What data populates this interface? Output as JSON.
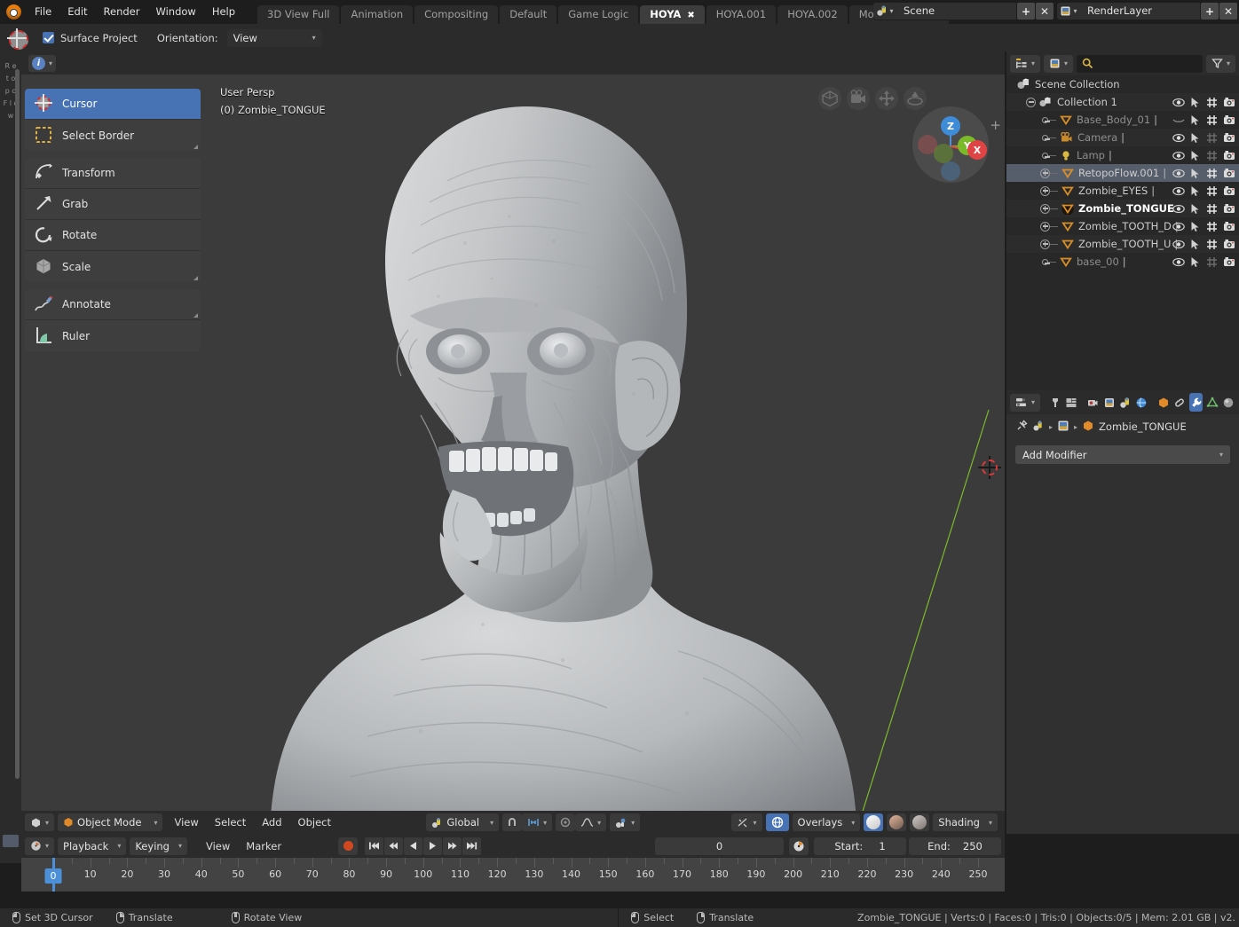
{
  "topbar": {
    "logo_icon": "blender-logo-icon",
    "menus": [
      "File",
      "Edit",
      "Render",
      "Window",
      "Help"
    ],
    "workspace_tabs": [
      {
        "label": "3D View Full",
        "active": false,
        "closable": false
      },
      {
        "label": "Animation",
        "active": false,
        "closable": false
      },
      {
        "label": "Compositing",
        "active": false,
        "closable": false
      },
      {
        "label": "Default",
        "active": false,
        "closable": false
      },
      {
        "label": "Game Logic",
        "active": false,
        "closable": false
      },
      {
        "label": "HOYA",
        "active": true,
        "closable": true
      },
      {
        "label": "HOYA.001",
        "active": false,
        "closable": false
      },
      {
        "label": "HOYA.002",
        "active": false,
        "closable": false
      },
      {
        "label": "Motion Tracking",
        "active": false,
        "closable": false
      }
    ],
    "scene_datablock": {
      "icon": "scene-icon",
      "value": "Scene",
      "add_label": "+",
      "remove_label": "✕"
    },
    "renderlayer_datablock": {
      "icon": "renderlayer-icon",
      "value": "RenderLayer",
      "add_label": "+",
      "remove_label": "✕"
    }
  },
  "tool_settings": {
    "gizmo_icon": "3d-cursor-icon",
    "checkbox_label": "Surface Project",
    "checkbox_checked": true,
    "orientation_label": "Orientation:",
    "orientation_value": "View"
  },
  "viewport": {
    "header_info_icon": "info-icon",
    "overlay_line1": "User Persp",
    "overlay_line2": "(0) Zombie_TONGUE",
    "plus_label": "+",
    "gizmos": [
      "perspective-ortho-icon",
      "camera-view-icon",
      "move-view-icon",
      "zoom-view-icon"
    ],
    "axis_gizmo": {
      "z": "Z",
      "y": "Y",
      "x": "X"
    },
    "cursor_icon": "3d-cursor-icon"
  },
  "toolbar": {
    "groups": [
      [
        {
          "label": "Cursor",
          "icon": "cursor-tool-icon",
          "selected": true,
          "has_submenu": false
        },
        {
          "label": "Select Border",
          "icon": "select-border-icon",
          "selected": false,
          "has_submenu": true
        }
      ],
      [
        {
          "label": "Transform",
          "icon": "transform-icon",
          "selected": false,
          "has_submenu": false
        },
        {
          "label": "Grab",
          "icon": "grab-icon",
          "selected": false,
          "has_submenu": false
        },
        {
          "label": "Rotate",
          "icon": "rotate-icon",
          "selected": false,
          "has_submenu": false
        },
        {
          "label": "Scale",
          "icon": "scale-icon",
          "selected": false,
          "has_submenu": true
        }
      ],
      [
        {
          "label": "Annotate",
          "icon": "annotate-icon",
          "selected": false,
          "has_submenu": true
        },
        {
          "label": "Ruler",
          "icon": "ruler-icon",
          "selected": false,
          "has_submenu": false
        }
      ]
    ]
  },
  "viewport_footer": {
    "editor_type_icon": "editor-type-icon",
    "mode": "Object Mode",
    "menus": [
      "View",
      "Select",
      "Add",
      "Object"
    ],
    "transform_orientation": "Global",
    "snap_icon": "snap-magnet-icon",
    "pivot_icon": "pivot-icon",
    "proportional_icon": "proportional-edit-icon",
    "falloff_icon": "falloff-curve-icon",
    "gizmo_icon": "gizmo-icon",
    "xray_icon": "xray-icon",
    "overlays_label": "Overlays",
    "shading_label": "Shading",
    "shading_modes": [
      "wireframe-solid-ball",
      "material-ball",
      "rendered-ball"
    ]
  },
  "timeline": {
    "editor_icon": "timeline-icon",
    "menus_dropdown": [
      "Playback",
      "Keying"
    ],
    "menus": [
      "View",
      "Marker"
    ],
    "record_icon": "record-icon",
    "transport": [
      "jump-start-icon",
      "prev-keyframe-icon",
      "play-reverse-icon",
      "play-icon",
      "next-keyframe-icon",
      "jump-end-icon"
    ],
    "current_frame": "0",
    "autokey_icon": "auto-keying-icon",
    "start_label": "Start:",
    "start_value": "1",
    "end_label": "End:",
    "end_value": "250",
    "ruler_ticks": [
      0,
      10,
      20,
      30,
      40,
      50,
      60,
      70,
      80,
      90,
      100,
      110,
      120,
      130,
      140,
      150,
      160,
      170,
      180,
      190,
      200,
      210,
      220,
      230,
      240,
      250
    ],
    "playhead_frame": "0"
  },
  "outliner": {
    "display_mode_icon": "outliner-display-icon",
    "filter_datablock_icon": "filter-datablock-icon",
    "search_icon": "search-icon",
    "search_placeholder": "",
    "filter_icon": "funnel-icon",
    "columns": [
      "visibility-eye",
      "selectable-arrow",
      "disable-viewport",
      "disable-render"
    ],
    "rows": [
      {
        "label": "Scene Collection",
        "icon": "scene-collection-icon",
        "indent": 0,
        "dim": false,
        "selected": false,
        "expander": "none",
        "icons": false
      },
      {
        "label": "Collection 1",
        "icon": "collection-icon",
        "indent": 1,
        "dim": false,
        "selected": false,
        "expander": "minus",
        "icons": true,
        "render_dim": false
      },
      {
        "label": "Base_Body_01",
        "icon": "mesh-icon",
        "indent": 2,
        "dim": true,
        "selected": false,
        "expander": "dot",
        "icons": true,
        "eye_closed": true,
        "render_dim": false
      },
      {
        "label": "Camera",
        "icon": "camera-icon",
        "indent": 2,
        "dim": true,
        "selected": false,
        "expander": "dot",
        "icons": true,
        "render_dim": true
      },
      {
        "label": "Lamp",
        "icon": "lamp-icon",
        "indent": 2,
        "dim": true,
        "selected": false,
        "expander": "dot",
        "icons": true,
        "render_dim": true
      },
      {
        "label": "RetopoFlow.001",
        "icon": "mesh-icon",
        "indent": 2,
        "dim": false,
        "selected": true,
        "expander": "plus",
        "icons": true,
        "render_dim": false
      },
      {
        "label": "Zombie_EYES",
        "icon": "mesh-icon",
        "indent": 2,
        "dim": false,
        "selected": false,
        "expander": "plus",
        "icons": true,
        "render_dim": false
      },
      {
        "label": "Zombie_TONGUE",
        "icon": "mesh-icon-active",
        "indent": 2,
        "dim": false,
        "active": true,
        "selected": false,
        "expander": "plus",
        "icons": true,
        "render_dim": false
      },
      {
        "label": "Zombie_TOOTH_D",
        "icon": "mesh-icon",
        "indent": 2,
        "dim": false,
        "selected": false,
        "expander": "plus",
        "icons": true,
        "render_dim": false
      },
      {
        "label": "Zombie_TOOTH_U",
        "icon": "mesh-icon",
        "indent": 2,
        "dim": false,
        "selected": false,
        "expander": "plus",
        "icons": true,
        "render_dim": false
      },
      {
        "label": "base_00",
        "icon": "mesh-icon",
        "indent": 2,
        "dim": true,
        "selected": false,
        "expander": "dot",
        "icons": true,
        "render_dim": true
      }
    ]
  },
  "properties": {
    "editor_icon": "properties-editor-icon",
    "tabs": [
      {
        "name": "tool-tab",
        "active": false
      },
      {
        "name": "render-tab",
        "active": false
      },
      {
        "name": "output-tab",
        "active": false
      },
      {
        "name": "viewlayer-tab",
        "active": false
      },
      {
        "name": "scene-tab",
        "active": false
      },
      {
        "name": "world-tab",
        "active": false
      },
      {
        "name": "object-tab",
        "active": false
      },
      {
        "name": "constraints-tab",
        "active": false
      },
      {
        "name": "modifier-tab",
        "active": true
      },
      {
        "name": "data-tab",
        "active": false
      },
      {
        "name": "material-tab",
        "active": false
      }
    ],
    "breadcrumb": {
      "pin_icon": "pin-icon",
      "scene_icon": "scene-icon",
      "viewlayer_icon": "renderlayer-icon",
      "object_icon": "object-icon",
      "object_name": "Zombie_TONGUE"
    },
    "add_modifier_label": "Add Modifier"
  },
  "statusbar": {
    "hints": [
      {
        "mouse": "left",
        "label": "Set 3D Cursor"
      },
      {
        "mouse": "right",
        "label": "Translate"
      },
      {
        "mouse": "mid",
        "label": "Rotate View"
      },
      {
        "mouse": "left",
        "label": "Select"
      },
      {
        "mouse": "right",
        "label": "Translate"
      }
    ],
    "stats": "Zombie_TONGUE | Verts:0 | Faces:0 | Tris:0 | Objects:0/5 | Mem: 2.01 GB | v2."
  },
  "colors": {
    "accent_blue": "#4772b3",
    "orange": "#e87d0d",
    "mesh_orange": "#d98e28",
    "axis_x": "#e04343",
    "axis_y": "#7cba2a",
    "axis_z": "#3e8bd8",
    "bg_dark": "#1d1d1d",
    "bg_panel": "#2b2b2b",
    "bg_viewport": "#3b3b3b"
  }
}
